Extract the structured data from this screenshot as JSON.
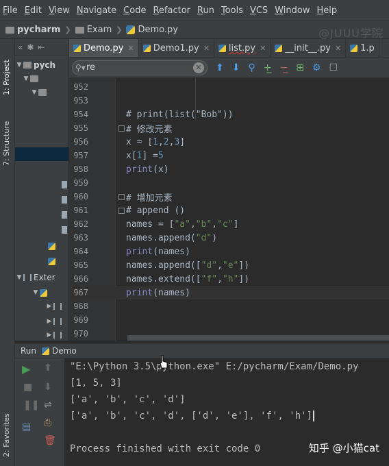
{
  "menu": [
    "File",
    "Edit",
    "View",
    "Navigate",
    "Code",
    "Refactor",
    "Run",
    "Tools",
    "VCS",
    "Window",
    "Help"
  ],
  "breadcrumb": {
    "project": "pycharm",
    "folder": "Exam",
    "file": "Demo.py"
  },
  "watermark": "@JUUU学院",
  "side_tabs": {
    "project": "1: Project",
    "structure": "7: Structure",
    "favorites": "2: Favorites"
  },
  "project_panel": {
    "root": "pych",
    "external": "Exter"
  },
  "tabs": [
    {
      "label": "Demo.py",
      "active": true
    },
    {
      "label": "Demo1.py",
      "active": false
    },
    {
      "label": "list.py",
      "active": false
    },
    {
      "label": "__init__.py",
      "active": false
    },
    {
      "label": "1.p",
      "active": false
    }
  ],
  "search": {
    "value": "re"
  },
  "editor": {
    "lines": [
      {
        "n": "952"
      },
      {
        "n": "953"
      },
      {
        "n": "954"
      },
      {
        "n": "955"
      },
      {
        "n": "956"
      },
      {
        "n": "957"
      },
      {
        "n": "958"
      },
      {
        "n": "959"
      },
      {
        "n": "960"
      },
      {
        "n": "961"
      },
      {
        "n": "962"
      },
      {
        "n": "963"
      },
      {
        "n": "964"
      },
      {
        "n": "965"
      },
      {
        "n": "966"
      },
      {
        "n": "967"
      },
      {
        "n": "968"
      },
      {
        "n": "969"
      },
      {
        "n": "970"
      }
    ],
    "code": {
      "l954": "# print(list(\"Bob\"))",
      "l955": "# 修改元素",
      "l956a": "x = [",
      "l956b": "1",
      "l956c": ",",
      "l956d": "2",
      "l956e": ",",
      "l956f": "3",
      "l956g": "]",
      "l957a": "x[",
      "l957b": "1",
      "l957c": "] =",
      "l957d": "5",
      "l958a": "print",
      "l958b": "(x)",
      "l960": "# 增加元素",
      "l961": "# append ()",
      "l962a": "names = [",
      "l962b": "\"a\"",
      "l962c": ",",
      "l962d": "\"b\"",
      "l962e": ",",
      "l962f": "\"c\"",
      "l962g": "]",
      "l963a": "names.append(",
      "l963b": "\"d\"",
      "l963c": ")",
      "l964a": "print",
      "l964b": "(names)",
      "l965a": "names.append([",
      "l965b": "\"d\"",
      "l965c": ",",
      "l965d": "\"e\"",
      "l965e": "])",
      "l966a": "names.extend([",
      "l966b": "\"f\"",
      "l966c": ",",
      "l966d": "\"h\"",
      "l966e": "])",
      "l967a": "print",
      "l967b": "(names)"
    }
  },
  "run": {
    "label": "Run",
    "config": "Demo",
    "output": [
      "\"E:\\Python 3.5\\python.exe\" E:/pycharm/Exam/Demo.py",
      "[1, 5, 3]",
      "['a', 'b', 'c', 'd']",
      "['a', 'b', 'c', 'd', ['d', 'e'], 'f', 'h']",
      "",
      "Process finished with exit code 0"
    ]
  },
  "footer_watermark": "知乎 @小猫cat",
  "colors": {
    "keyword": "#8888c6",
    "comment": "#808080",
    "number": "#6897bb",
    "string": "#6a8759",
    "run_green": "#499c54",
    "accent_blue": "#4a9be3"
  }
}
